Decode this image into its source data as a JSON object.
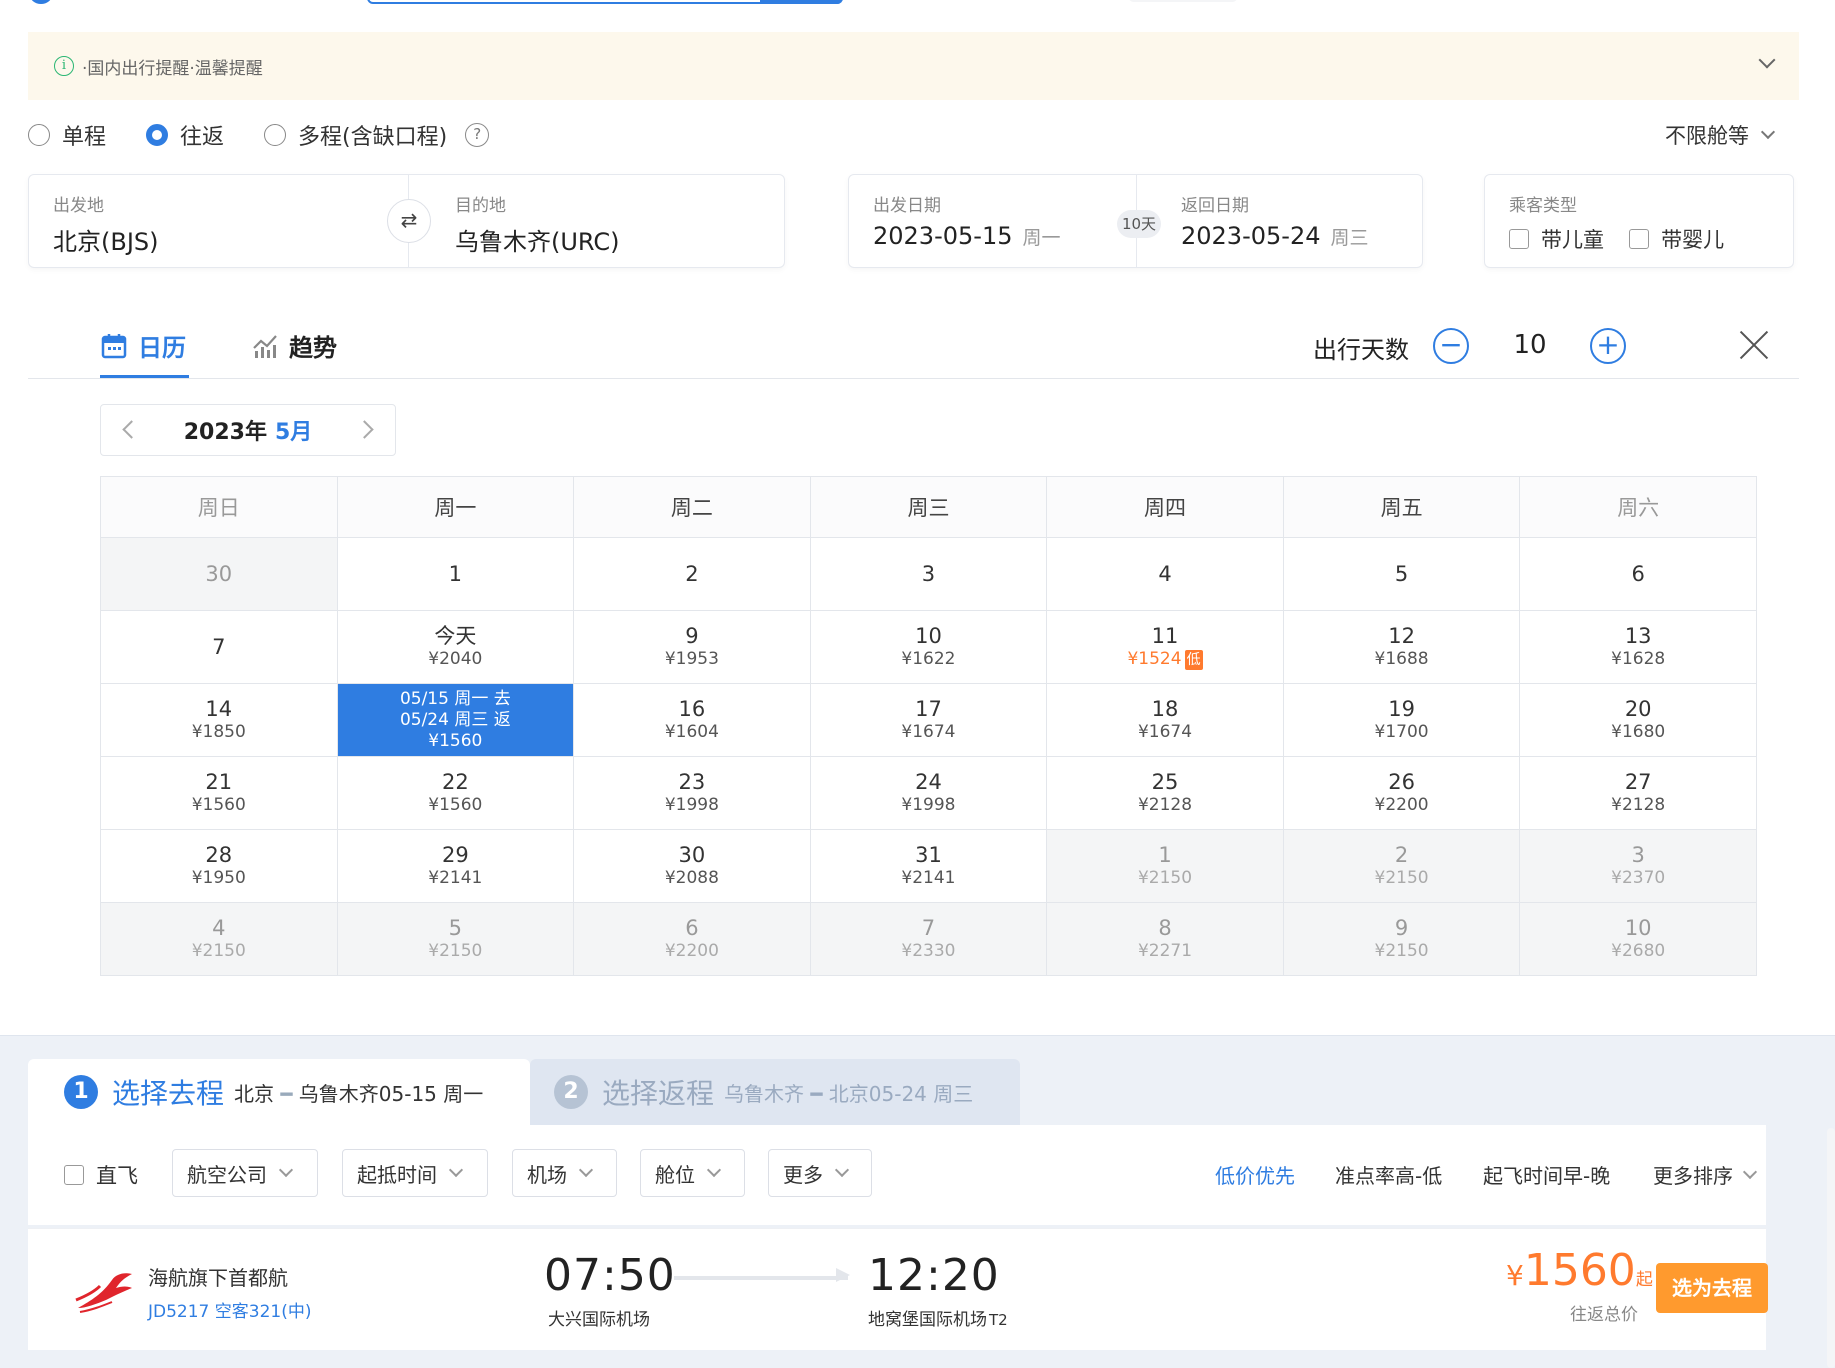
{
  "notice": {
    "text": "·国内出行提醒·温馨提醒"
  },
  "trip_types": [
    {
      "label": "单程",
      "selected": false
    },
    {
      "label": "往返",
      "selected": true
    },
    {
      "label": "多程(含缺口程)",
      "selected": false
    }
  ],
  "cabin_class": "不限舱等",
  "route": {
    "from_label": "出发地",
    "from_value": "北京(BJS)",
    "to_label": "目的地",
    "to_value": "乌鲁木齐(URC)"
  },
  "dates": {
    "depart_label": "出发日期",
    "depart_value": "2023-05-15",
    "depart_weekday": "周一",
    "return_label": "返回日期",
    "return_value": "2023-05-24",
    "return_weekday": "周三",
    "span": "10天"
  },
  "passenger": {
    "label": "乘客类型",
    "options": [
      "带儿童",
      "带婴儿"
    ]
  },
  "calendar_tabs": {
    "calendar": "日历",
    "trend": "趋势"
  },
  "trip_days": {
    "label": "出行天数",
    "value": "10"
  },
  "month_nav": {
    "year": "2023年",
    "month": "5月"
  },
  "weekdays": [
    "周日",
    "周一",
    "周二",
    "周三",
    "周四",
    "周五",
    "周六"
  ],
  "calendar": [
    [
      {
        "d": "30",
        "off": true
      },
      {
        "d": "1"
      },
      {
        "d": "2"
      },
      {
        "d": "3"
      },
      {
        "d": "4"
      },
      {
        "d": "5"
      },
      {
        "d": "6"
      }
    ],
    [
      {
        "d": "7"
      },
      {
        "d": "今天",
        "p": "¥2040"
      },
      {
        "d": "9",
        "p": "¥1953"
      },
      {
        "d": "10",
        "p": "¥1622"
      },
      {
        "d": "11",
        "p": "¥1524",
        "low": true
      },
      {
        "d": "12",
        "p": "¥1688"
      },
      {
        "d": "13",
        "p": "¥1628"
      }
    ],
    [
      {
        "d": "14",
        "p": "¥1850"
      },
      {
        "sel": true,
        "l1": "05/15 周一 去",
        "l2": "05/24 周三 返",
        "p": "¥1560"
      },
      {
        "d": "16",
        "p": "¥1604"
      },
      {
        "d": "17",
        "p": "¥1674"
      },
      {
        "d": "18",
        "p": "¥1674"
      },
      {
        "d": "19",
        "p": "¥1700"
      },
      {
        "d": "20",
        "p": "¥1680"
      }
    ],
    [
      {
        "d": "21",
        "p": "¥1560"
      },
      {
        "d": "22",
        "p": "¥1560"
      },
      {
        "d": "23",
        "p": "¥1998"
      },
      {
        "d": "24",
        "p": "¥1998"
      },
      {
        "d": "25",
        "p": "¥2128"
      },
      {
        "d": "26",
        "p": "¥2200"
      },
      {
        "d": "27",
        "p": "¥2128"
      }
    ],
    [
      {
        "d": "28",
        "p": "¥1950"
      },
      {
        "d": "29",
        "p": "¥2141"
      },
      {
        "d": "30",
        "p": "¥2088"
      },
      {
        "d": "31",
        "p": "¥2141"
      },
      {
        "d": "1",
        "p": "¥2150",
        "off": true
      },
      {
        "d": "2",
        "p": "¥2150",
        "off": true
      },
      {
        "d": "3",
        "p": "¥2370",
        "off": true
      }
    ],
    [
      {
        "d": "4",
        "p": "¥2150",
        "off": true
      },
      {
        "d": "5",
        "p": "¥2150",
        "off": true
      },
      {
        "d": "6",
        "p": "¥2200",
        "off": true
      },
      {
        "d": "7",
        "p": "¥2330",
        "off": true
      },
      {
        "d": "8",
        "p": "¥2271",
        "off": true
      },
      {
        "d": "9",
        "p": "¥2150",
        "off": true
      },
      {
        "d": "10",
        "p": "¥2680",
        "off": true
      }
    ]
  ],
  "low_tag": "低",
  "steps": [
    {
      "num": "1",
      "title": "选择去程",
      "from": "北京",
      "to": "乌鲁木齐",
      "date": "05-15 周一"
    },
    {
      "num": "2",
      "title": "选择返程",
      "from": "乌鲁木齐",
      "to": "北京",
      "date": "05-24 周三"
    }
  ],
  "filters": {
    "direct": "直飞",
    "airline": "航空公司",
    "time": "起抵时间",
    "airport": "机场",
    "cabin": "舱位",
    "more": "更多"
  },
  "sorts": {
    "low_price": "低价优先",
    "on_time": "准点率高-低",
    "depart": "起飞时间早-晚",
    "more_sort": "更多排序"
  },
  "flight": {
    "airline": "海航旗下首都航",
    "number": "JD5217 空客321(中)",
    "dep_time": "07:50",
    "dep_airport": "大兴国际机场",
    "arr_time": "12:20",
    "arr_airport": "地窝堡国际机场",
    "arr_terminal": "T2",
    "price_currency": "¥",
    "price": "1560",
    "price_suffix": "起",
    "price_note": "往返总价",
    "select_label": "选为去程"
  },
  "colors": {
    "accent": "#2f7de1",
    "orange": "#ff7a2e",
    "notice_bg": "#fdf8ec"
  }
}
